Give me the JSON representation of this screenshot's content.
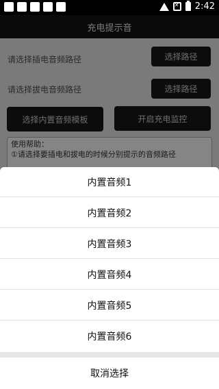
{
  "status_bar": {
    "time": "2:42"
  },
  "app": {
    "title": "充电提示音"
  },
  "main": {
    "plug_label": "请选择插电音频路径",
    "plug_button": "选择路径",
    "unplug_label": "请选择拔电音频路径",
    "unplug_button": "选择路径",
    "template_button": "选择内置音频模板",
    "monitor_button": "开启充电监控",
    "help_title": "使用帮助：",
    "help_line1": "①请选择要插电和拔电的时候分别提示的音频路径"
  },
  "sheet": {
    "items": [
      "内置音频1",
      "内置音频2",
      "内置音频3",
      "内置音频4",
      "内置音频5",
      "内置音频6"
    ],
    "cancel": "取消选择"
  }
}
